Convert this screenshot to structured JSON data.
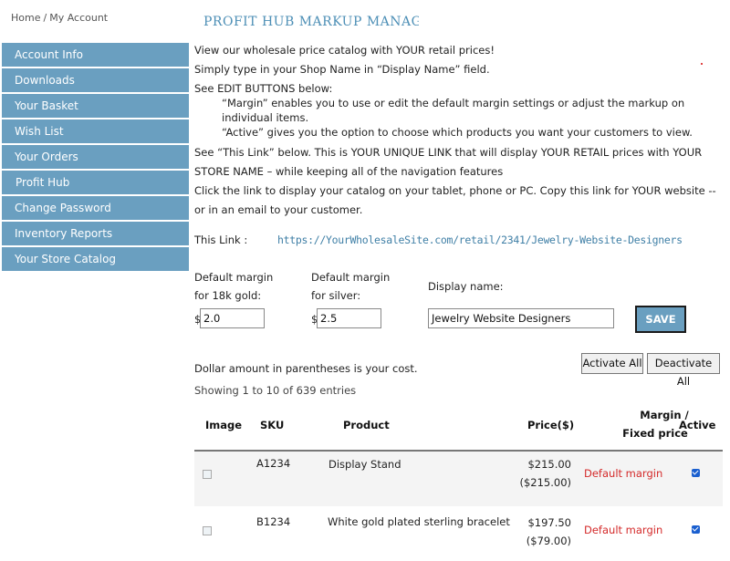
{
  "breadcrumb": {
    "home": "Home",
    "separator": "/",
    "current": "My Account"
  },
  "page_title": "PROFIT HUB MARKUP MANAGER",
  "sidebar": {
    "items": [
      {
        "label": "Account Info"
      },
      {
        "label": "Downloads"
      },
      {
        "label": "Your Basket"
      },
      {
        "label": "Wish List"
      },
      {
        "label": "Your Orders"
      },
      {
        "label": "Profit Hub"
      },
      {
        "label": "Change Password"
      },
      {
        "label": "Inventory Reports"
      },
      {
        "label": "Your Store Catalog"
      }
    ]
  },
  "intro": {
    "line1": "View our wholesale price catalog with YOUR retail prices!",
    "line2": "Simply type in your Shop Name in “Display Name” field.",
    "line3": "See EDIT BUTTONS below:",
    "margin_note": "“Margin” enables you to use or edit the default margin settings or adjust the markup on individual items.",
    "active_note": "“Active” gives you the option to choose which products you want your customers to view.",
    "link_note": "See “This Link” below. This is YOUR UNIQUE LINK that will display YOUR RETAIL prices with YOUR STORE NAME – while keeping all of the navigation features",
    "click_note": "Click the link to display your catalog on your tablet, phone or PC. Copy this link for YOUR website -- or in an email to your customer."
  },
  "this_link": {
    "label": "This Link :",
    "url": "https://YourWholesaleSite.com/retail/2341/Jewelry-Website-Designers"
  },
  "settings": {
    "gold_label_1": "Default margin",
    "gold_label_2": "for 18k gold:",
    "gold_value": "2.0",
    "silver_label_1": "Default margin",
    "silver_label_2": "for silver:",
    "silver_value": "2.5",
    "currency": "$",
    "display_name_label": "Display name:",
    "display_name_value": "Jewelry Website Designers",
    "save_label": "SAVE"
  },
  "actions": {
    "activate_all": "Activate All",
    "deactivate_all": "Deactivate All"
  },
  "cost_note": "Dollar amount in parentheses is your cost.",
  "showing": "Showing 1 to 10 of 639 entries",
  "table": {
    "headers": {
      "image": "Image",
      "sku": "SKU",
      "product": "Product",
      "price": "Price($)",
      "margin_1": "Margin /",
      "margin_2": "Fixed price",
      "active": "Active"
    },
    "rows": [
      {
        "sku": "A1234",
        "product": "Display Stand",
        "price": "$215.00",
        "cost": "($215.00)",
        "margin": "Default margin",
        "active": true
      },
      {
        "sku": "B1234",
        "product": "White gold plated sterling bracelet",
        "price": "$197.50",
        "cost": "($79.00)",
        "margin": "Default margin",
        "active": true
      }
    ]
  },
  "colors": {
    "accent": "#6a9fc0",
    "title": "#4d8fb6",
    "link": "#3f7fa6",
    "margin_text": "#d42a2a"
  }
}
